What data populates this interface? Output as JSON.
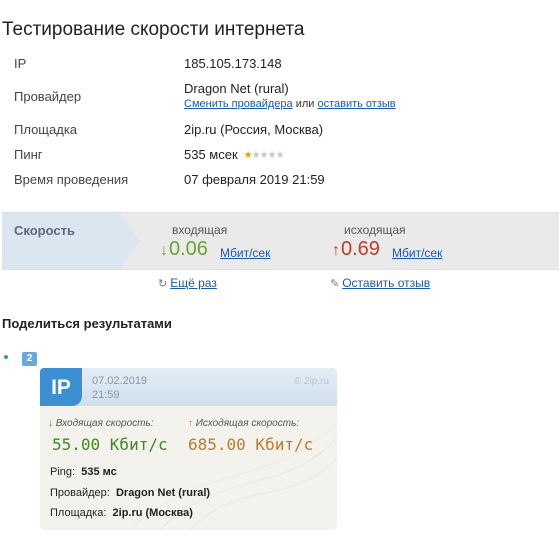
{
  "page_title": "Тестирование скорости интернета",
  "info": {
    "ip_label": "IP",
    "ip_value": "185.105.173.148",
    "provider_label": "Провайдер",
    "provider_value": "Dragon Net (rural)",
    "change_provider_link": "Сменить провайдера",
    "or_text": "или",
    "leave_review_link": "оставить отзыв",
    "site_label": "Площадка",
    "site_value": "2ip.ru (Россия, Москва)",
    "ping_label": "Пинг",
    "ping_value": "535 мсек",
    "ping_rating": 1,
    "ping_rating_max": 5,
    "time_label": "Время проведения",
    "time_value": "07 февраля 2019 21:59"
  },
  "speed": {
    "label": "Скорость",
    "incoming_title": "входящая",
    "incoming_arrow": "↓",
    "incoming_value": "0.06",
    "incoming_unit": "Мбит/сек",
    "outgoing_title": "исходящая",
    "outgoing_arrow": "↑",
    "outgoing_value": "0.69",
    "outgoing_unit": "Мбит/сек",
    "incoming_color": "#6aa52d",
    "outgoing_color": "#c23a2c"
  },
  "actions": {
    "retry_icon": "↻",
    "retry": "Ещё раз",
    "review_icon": "✎",
    "review": "Оставить отзыв"
  },
  "share": {
    "title": "Поделиться результатами",
    "mini_icon_text": "2"
  },
  "card": {
    "logo": "IP",
    "date": "07.02.2019",
    "time": "21:59",
    "site": "© 2ip.ru",
    "in_arrow": "↓",
    "in_title": "Входящая скорость:",
    "in_value": "55.00 Кбит/с",
    "out_arrow": "↑",
    "out_title": "Исходящая скорость:",
    "out_value": "685.00 Кбит/с",
    "ping_label": "Ping:",
    "ping_value": "535 мс",
    "provider_label": "Провайдер:",
    "provider_value": "Dragon Net (rural)",
    "site_label": "Площадка:",
    "site_value": "2ip.ru (Москва)",
    "in_color": "#3f8a1e",
    "out_color": "#c07a2a"
  }
}
